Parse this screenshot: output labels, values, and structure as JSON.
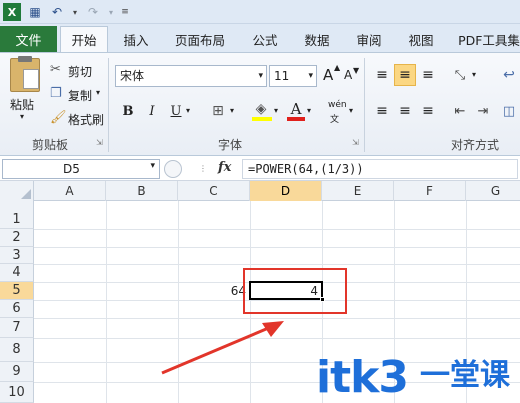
{
  "tabs": [
    "文件",
    "开始",
    "插入",
    "页面布局",
    "公式",
    "数据",
    "审阅",
    "视图",
    "PDF工具集"
  ],
  "ribbon": {
    "clipboard": {
      "paste": "粘贴",
      "cut": "剪切",
      "copy": "复制",
      "format_painter": "格式刷",
      "label": "剪贴板"
    },
    "font": {
      "name": "宋体",
      "size": "11",
      "grow": "A",
      "shrink": "A",
      "bold": "B",
      "italic": "I",
      "underline": "U",
      "font_color_glyph": "A",
      "phonetic_glyph": "wén",
      "label": "字体"
    },
    "alignment": {
      "label": "对齐方式"
    }
  },
  "formula_bar": {
    "name_box": "D5",
    "fx": "fx",
    "formula": "=POWER(64,(1/3))"
  },
  "columns": [
    "A",
    "B",
    "C",
    "D",
    "E",
    "F",
    "G"
  ],
  "rows": [
    "1",
    "2",
    "3",
    "4",
    "5",
    "6",
    "7",
    "8",
    "9",
    "10"
  ],
  "cells": {
    "C5": "64",
    "D5": "4"
  },
  "selected_cell": "D5",
  "watermark": {
    "latin": "itk3",
    "cjk": "一堂课"
  },
  "colors": {
    "file_tab": "#2a7a3b",
    "annotation": "#e2352a",
    "selection_header": "#f9d99a",
    "watermark": "#1e6fd9"
  }
}
